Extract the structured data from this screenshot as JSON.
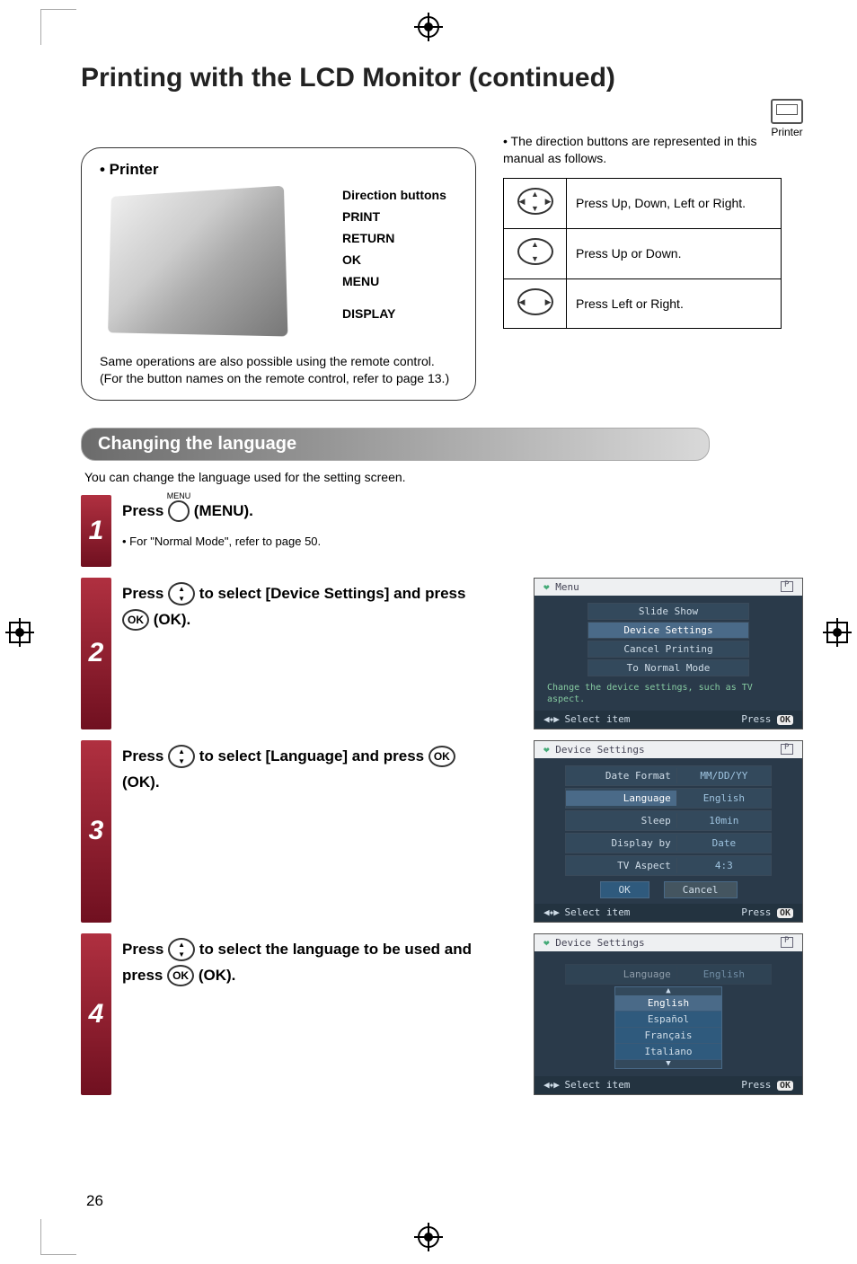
{
  "page_number": "26",
  "title": "Printing with the LCD Monitor (continued)",
  "printer_corner_label": "Printer",
  "printer_box": {
    "heading": "• Printer",
    "callouts": {
      "direction": "Direction buttons",
      "print": "PRINT",
      "return": "RETURN",
      "ok": "OK",
      "menu": "MENU",
      "display": "DISPLAY"
    },
    "note": "Same operations are also possible using the remote control. (For the button names on the remote control, refer to page 13.)"
  },
  "direction_note": {
    "bullet": "The direction buttons are represented in this manual as follows.",
    "rows": [
      "Press Up, Down, Left or Right.",
      "Press Up or Down.",
      "Press Left or Right."
    ]
  },
  "section_heading": "Changing the language",
  "intro": "You can change the language used for the setting screen.",
  "steps": {
    "s1": {
      "num": "1",
      "text_before": "Press ",
      "text_after": " (MENU).",
      "sub": "•  For \"Normal Mode\", refer to page 50."
    },
    "s2": {
      "num": "2",
      "text_a": "Press ",
      "text_b": " to select [Device Settings] and press ",
      "text_c": " (OK)."
    },
    "s3": {
      "num": "3",
      "text_a": "Press ",
      "text_b": " to select [Language] and press ",
      "text_c": " (OK)."
    },
    "s4": {
      "num": "4",
      "text_a": "Press ",
      "text_b": " to select the language to be used and press ",
      "text_c": " (OK)."
    }
  },
  "lcd": {
    "menu_title": "Menu",
    "device_settings_title": "Device Settings",
    "screen1": {
      "items": [
        "Slide Show",
        "Device Settings",
        "Cancel Printing",
        "To Normal Mode"
      ],
      "help": "Change the device settings, such as TV aspect.",
      "footer_left": "Select item",
      "footer_right": "Press",
      "ok": "OK"
    },
    "screen2": {
      "rows": [
        {
          "k": "Date Format",
          "v": "MM/DD/YY"
        },
        {
          "k": "Language",
          "v": "English"
        },
        {
          "k": "Sleep",
          "v": "10min"
        },
        {
          "k": "Display by",
          "v": "Date"
        },
        {
          "k": "TV Aspect",
          "v": "4:3"
        }
      ],
      "btn_ok": "OK",
      "btn_cancel": "Cancel",
      "footer_left": "Select item",
      "footer_right": "Press",
      "ok": "OK"
    },
    "screen3": {
      "row": {
        "k": "Language",
        "v": "English"
      },
      "options": [
        "English",
        "Español",
        "Français",
        "Italiano"
      ],
      "footer_left": "Select item",
      "footer_right": "Press",
      "ok": "OK"
    }
  }
}
